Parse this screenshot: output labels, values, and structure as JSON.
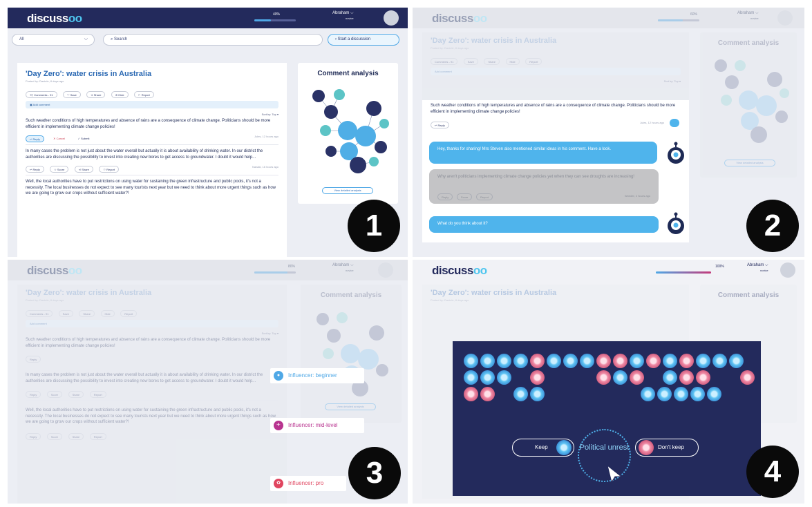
{
  "app": {
    "logo_text": "discuss",
    "logo_mark": "oo",
    "user_name": "Abraham",
    "user_role": "novice",
    "colors": {
      "navy": "#232a5c",
      "accent": "#4fa8e6",
      "keep": "#4fb4ec",
      "dont_keep": "#e98aa4"
    }
  },
  "q1": {
    "progress_label": "40%",
    "progress": 0.4,
    "filter_value": "All",
    "search_placeholder": "Search",
    "start_label": "Start a discussion",
    "title": "'Day Zero': water crisis in Australia",
    "posted_by": "Posted by: Daniele, 8 days ago",
    "actions": [
      "Comments - 91",
      "Save",
      "Share",
      "Hide",
      "Report"
    ],
    "add_comment": "Add comment",
    "sort": "Sort by: Top",
    "comments": [
      {
        "text": "Such weather conditions of high temperatures and absence of rains are a consequence of climate change. Politicians should be more efficient in implementing climate change policies!",
        "reply": "Reply",
        "cancel": "Cancel",
        "submit": "Submit",
        "time": "Jules, 12 hours ago"
      },
      {
        "text": "In many cases the problem is not just about the water overall but actually it is about availability of drinking water. In our district the authorities are discussing the possibility to invest into creating new bores to get access to groundwater. I doubt it would help...",
        "actions": [
          "Reply",
          "Score",
          "Share",
          "Report"
        ],
        "time": "Nanaki, 16 hours ago"
      },
      {
        "text": "Well, the local authorities have to put restrictions on using water for sustaining the green infrastructure and public pools, it's not a necessity. The local businesses do not expect to see many tourists next year but we need to think about more urgent things such as how we are going to grow our crops without sufficient water?!"
      }
    ],
    "panel_title": "Comment analysis",
    "view_analysis": "View detailed analysis",
    "badge": "1"
  },
  "q2": {
    "progress_label": "60%",
    "progress": 0.6,
    "chat": {
      "bot1": "Hey, thanks for sharing! Mrs Steven also mentioned similar ideas in his comment. Have a look.",
      "grey": "Why aren't politicians implementing climate change policies yet when they can see droughts are increasing!",
      "grey_actions": [
        "Reply",
        "Score",
        "Report"
      ],
      "grey_time": "Wonder, 2 hours ago",
      "bot2": "What do you think about it?"
    },
    "badge": "2"
  },
  "q3": {
    "progress_label": "80%",
    "progress": 0.8,
    "influencers": [
      {
        "label": "Influencer: beginner",
        "color": "#4fa8e6"
      },
      {
        "label": "Influencer: mid-level",
        "color": "#b8338f"
      },
      {
        "label": "Influencer: pro",
        "color": "#e0455f"
      }
    ],
    "badge": "3"
  },
  "q4": {
    "progress_label": "100%",
    "progress": 1.0,
    "keep_label": "Keep",
    "dont_keep_label": "Don't keep",
    "topic": "Political unrest",
    "badge": "4"
  }
}
